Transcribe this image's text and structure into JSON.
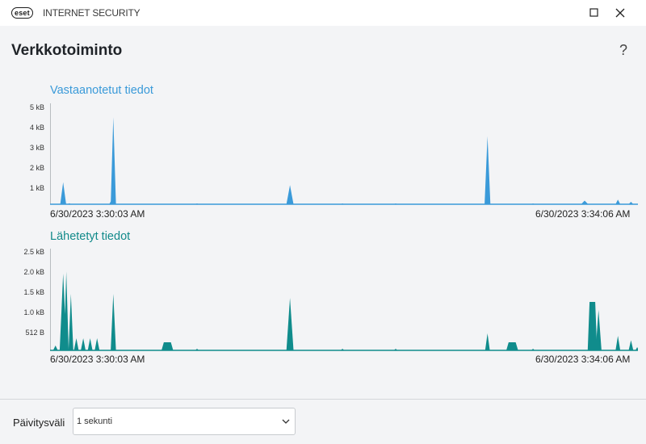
{
  "app": {
    "logo_text": "eset",
    "product_name": "INTERNET SECURITY"
  },
  "page": {
    "title": "Verkkotoiminto",
    "help_label": "?"
  },
  "colors": {
    "received": "#3a9ad9",
    "sent": "#108c8c",
    "title_sent": "#128a8a"
  },
  "chart_data": [
    {
      "type": "area",
      "title": "Vastaanotetut tiedot",
      "y_ticks": [
        "5 kB",
        "4 kB",
        "3 kB",
        "2 kB",
        "1 kB"
      ],
      "ylim": [
        0,
        5000
      ],
      "x_range_labels": [
        "6/30/2023 3:30:03 AM",
        "6/30/2023 3:34:06 AM"
      ],
      "spikes": [
        {
          "t": 0.0223,
          "v": 1100,
          "w": 0.005
        },
        {
          "t": 0.0328,
          "v": 50,
          "w": 0.003
        },
        {
          "t": 0.1076,
          "v": 4350,
          "w": 0.0045
        },
        {
          "t": 0.1036,
          "v": 150,
          "w": 0.003
        },
        {
          "t": 0.25,
          "v": 40,
          "w": 0.003
        },
        {
          "t": 0.4081,
          "v": 950,
          "w": 0.006
        },
        {
          "t": 0.4974,
          "v": 40,
          "w": 0.003
        },
        {
          "t": 0.5879,
          "v": 40,
          "w": 0.003
        },
        {
          "t": 0.7441,
          "v": 3400,
          "w": 0.005
        },
        {
          "t": 0.8215,
          "v": 40,
          "w": 0.003
        },
        {
          "t": 0.9094,
          "v": 180,
          "w": 0.006
        },
        {
          "t": 0.9659,
          "v": 230,
          "w": 0.004
        },
        {
          "t": 0.9882,
          "v": 120,
          "w": 0.004
        }
      ]
    },
    {
      "type": "area",
      "title": "Lähetetyt tiedot",
      "y_ticks": [
        "2.5 kB",
        "2.0 kB",
        "1.5 kB",
        "1.0 kB",
        "512 B"
      ],
      "y_tick_values": [
        2500,
        2000,
        1500,
        1000,
        512
      ],
      "ylim": [
        0,
        2500
      ],
      "x_range_labels": [
        "6/30/2023 3:30:03 AM",
        "6/30/2023 3:34:06 AM"
      ],
      "spikes": [
        {
          "t": 0.0092,
          "v": 120,
          "w": 0.004
        },
        {
          "t": 0.0223,
          "v": 1900,
          "w": 0.006
        },
        {
          "t": 0.0276,
          "v": 1950,
          "w": 0.004
        },
        {
          "t": 0.0355,
          "v": 1400,
          "w": 0.004
        },
        {
          "t": 0.0446,
          "v": 300,
          "w": 0.004
        },
        {
          "t": 0.0564,
          "v": 300,
          "w": 0.004
        },
        {
          "t": 0.0682,
          "v": 300,
          "w": 0.004
        },
        {
          "t": 0.08,
          "v": 300,
          "w": 0.004
        },
        {
          "t": 0.1076,
          "v": 1400,
          "w": 0.0045
        },
        {
          "t": 0.1995,
          "v": 200,
          "w": 0.01
        },
        {
          "t": 0.25,
          "v": 40,
          "w": 0.003
        },
        {
          "t": 0.4081,
          "v": 1300,
          "w": 0.006
        },
        {
          "t": 0.4974,
          "v": 40,
          "w": 0.003
        },
        {
          "t": 0.5879,
          "v": 40,
          "w": 0.003
        },
        {
          "t": 0.7441,
          "v": 420,
          "w": 0.004
        },
        {
          "t": 0.7861,
          "v": 200,
          "w": 0.01
        },
        {
          "t": 0.8215,
          "v": 40,
          "w": 0.003
        },
        {
          "t": 0.9225,
          "v": 1200,
          "w": 0.008
        },
        {
          "t": 0.933,
          "v": 1000,
          "w": 0.005
        },
        {
          "t": 0.9659,
          "v": 360,
          "w": 0.004
        },
        {
          "t": 0.9882,
          "v": 250,
          "w": 0.004
        },
        {
          "t": 0.9987,
          "v": 80,
          "w": 0.003
        }
      ]
    }
  ],
  "footer": {
    "interval_label": "Päivitysväli",
    "interval_value": "1 sekunti"
  }
}
